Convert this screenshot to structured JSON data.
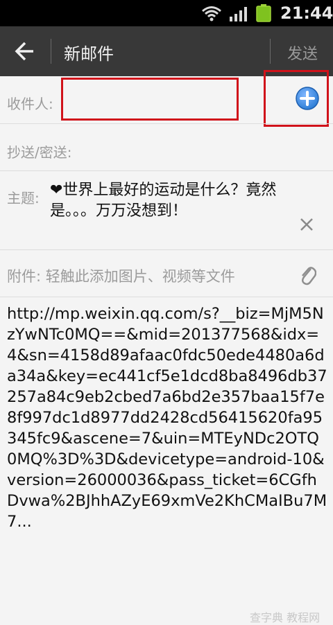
{
  "status_bar": {
    "time": "21:44"
  },
  "header": {
    "title": "新邮件",
    "send_label": "发送"
  },
  "form": {
    "to_label": "收件人:",
    "to_value": "",
    "cc_label": "抄送/密送:",
    "subject_label": "主题:",
    "subject_value": "❤世界上最好的运动是什么？竟然是。。。万万没想到！",
    "attachment_label": "附件: 轻触此添加图片、视频等文件"
  },
  "body": {
    "text": "http://mp.weixin.qq.com/s?__biz=MjM5NzYwNTc0MQ==&mid=201377568&idx=4&sn=4158d89afaac0fdc50ede4480a6da34a&key=ec441cf5e1dcd8ba8496db37257a84c9eb2cbed7a6bd2e357baa15f7e8f997dc1d8977dd2428cd56415620fa95345fc9&ascene=7&uin=MTEyNDc2OTQ0MQ%3D%3D&devicetype=android-10&version=26000036&pass_ticket=6CGfhDvwa%2BJhhAZyE69xmVe2KhCMaIBu7M7..."
  },
  "watermark": "查字典 教程网",
  "colors": {
    "status_bg": "#000000",
    "title_bg": "#383838",
    "highlight_red": "#d0121a",
    "add_blue": "#2f7fd6"
  },
  "icons": {
    "back": "back-arrow-icon",
    "add": "plus-circle-icon",
    "clear": "close-icon",
    "attachment": "paperclip-icon",
    "wifi": "wifi-icon",
    "signal": "signal-icon",
    "battery": "battery-icon"
  }
}
